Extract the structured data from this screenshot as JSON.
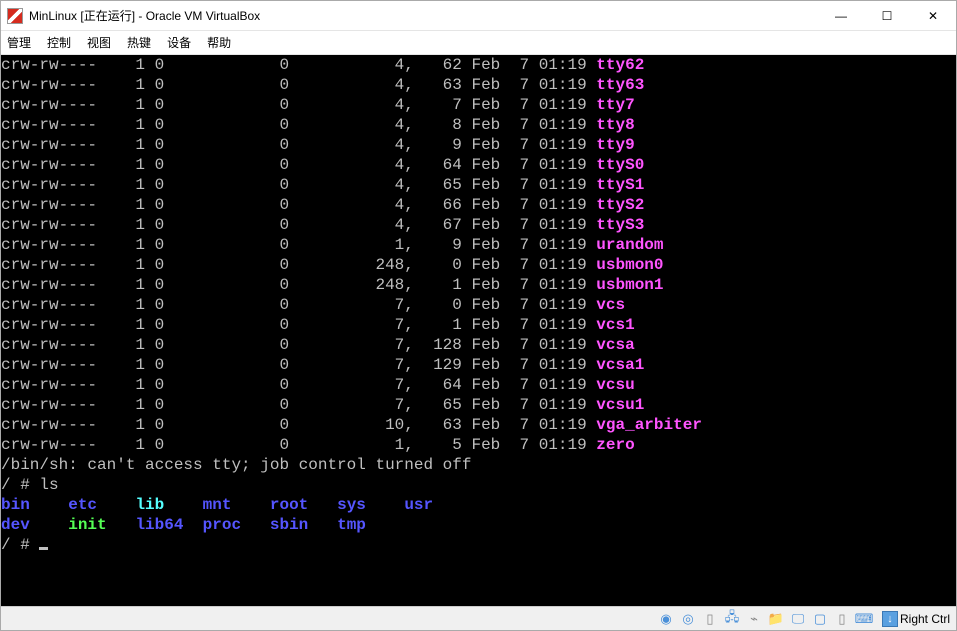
{
  "window": {
    "title": "MinLinux [正在运行] - Oracle VM VirtualBox"
  },
  "menu": {
    "items": [
      "管理",
      "控制",
      "视图",
      "热键",
      "设备",
      "帮助"
    ]
  },
  "terminal": {
    "listing": [
      {
        "perm": "crw-rw----",
        "links": "1",
        "owner": "0",
        "size": "0",
        "maj": "4,",
        "min": "62",
        "mon": "Feb",
        "day": "7",
        "time": "01:19",
        "name": "tty62",
        "cls": "magenta"
      },
      {
        "perm": "crw-rw----",
        "links": "1",
        "owner": "0",
        "size": "0",
        "maj": "4,",
        "min": "63",
        "mon": "Feb",
        "day": "7",
        "time": "01:19",
        "name": "tty63",
        "cls": "magenta"
      },
      {
        "perm": "crw-rw----",
        "links": "1",
        "owner": "0",
        "size": "0",
        "maj": "4,",
        "min": "7",
        "mon": "Feb",
        "day": "7",
        "time": "01:19",
        "name": "tty7",
        "cls": "magenta"
      },
      {
        "perm": "crw-rw----",
        "links": "1",
        "owner": "0",
        "size": "0",
        "maj": "4,",
        "min": "8",
        "mon": "Feb",
        "day": "7",
        "time": "01:19",
        "name": "tty8",
        "cls": "magenta"
      },
      {
        "perm": "crw-rw----",
        "links": "1",
        "owner": "0",
        "size": "0",
        "maj": "4,",
        "min": "9",
        "mon": "Feb",
        "day": "7",
        "time": "01:19",
        "name": "tty9",
        "cls": "magenta"
      },
      {
        "perm": "crw-rw----",
        "links": "1",
        "owner": "0",
        "size": "0",
        "maj": "4,",
        "min": "64",
        "mon": "Feb",
        "day": "7",
        "time": "01:19",
        "name": "ttyS0",
        "cls": "magenta"
      },
      {
        "perm": "crw-rw----",
        "links": "1",
        "owner": "0",
        "size": "0",
        "maj": "4,",
        "min": "65",
        "mon": "Feb",
        "day": "7",
        "time": "01:19",
        "name": "ttyS1",
        "cls": "magenta"
      },
      {
        "perm": "crw-rw----",
        "links": "1",
        "owner": "0",
        "size": "0",
        "maj": "4,",
        "min": "66",
        "mon": "Feb",
        "day": "7",
        "time": "01:19",
        "name": "ttyS2",
        "cls": "magenta"
      },
      {
        "perm": "crw-rw----",
        "links": "1",
        "owner": "0",
        "size": "0",
        "maj": "4,",
        "min": "67",
        "mon": "Feb",
        "day": "7",
        "time": "01:19",
        "name": "ttyS3",
        "cls": "magenta"
      },
      {
        "perm": "crw-rw----",
        "links": "1",
        "owner": "0",
        "size": "0",
        "maj": "1,",
        "min": "9",
        "mon": "Feb",
        "day": "7",
        "time": "01:19",
        "name": "urandom",
        "cls": "magenta"
      },
      {
        "perm": "crw-rw----",
        "links": "1",
        "owner": "0",
        "size": "0",
        "maj": "248,",
        "min": "0",
        "mon": "Feb",
        "day": "7",
        "time": "01:19",
        "name": "usbmon0",
        "cls": "magenta"
      },
      {
        "perm": "crw-rw----",
        "links": "1",
        "owner": "0",
        "size": "0",
        "maj": "248,",
        "min": "1",
        "mon": "Feb",
        "day": "7",
        "time": "01:19",
        "name": "usbmon1",
        "cls": "magenta"
      },
      {
        "perm": "crw-rw----",
        "links": "1",
        "owner": "0",
        "size": "0",
        "maj": "7,",
        "min": "0",
        "mon": "Feb",
        "day": "7",
        "time": "01:19",
        "name": "vcs",
        "cls": "magenta"
      },
      {
        "perm": "crw-rw----",
        "links": "1",
        "owner": "0",
        "size": "0",
        "maj": "7,",
        "min": "1",
        "mon": "Feb",
        "day": "7",
        "time": "01:19",
        "name": "vcs1",
        "cls": "magenta"
      },
      {
        "perm": "crw-rw----",
        "links": "1",
        "owner": "0",
        "size": "0",
        "maj": "7,",
        "min": "128",
        "mon": "Feb",
        "day": "7",
        "time": "01:19",
        "name": "vcsa",
        "cls": "magenta"
      },
      {
        "perm": "crw-rw----",
        "links": "1",
        "owner": "0",
        "size": "0",
        "maj": "7,",
        "min": "129",
        "mon": "Feb",
        "day": "7",
        "time": "01:19",
        "name": "vcsa1",
        "cls": "magenta"
      },
      {
        "perm": "crw-rw----",
        "links": "1",
        "owner": "0",
        "size": "0",
        "maj": "7,",
        "min": "64",
        "mon": "Feb",
        "day": "7",
        "time": "01:19",
        "name": "vcsu",
        "cls": "magenta"
      },
      {
        "perm": "crw-rw----",
        "links": "1",
        "owner": "0",
        "size": "0",
        "maj": "7,",
        "min": "65",
        "mon": "Feb",
        "day": "7",
        "time": "01:19",
        "name": "vcsu1",
        "cls": "magenta"
      },
      {
        "perm": "crw-rw----",
        "links": "1",
        "owner": "0",
        "size": "0",
        "maj": "10,",
        "min": "63",
        "mon": "Feb",
        "day": "7",
        "time": "01:19",
        "name": "vga_arbiter",
        "cls": "magenta"
      },
      {
        "perm": "crw-rw----",
        "links": "1",
        "owner": "0",
        "size": "0",
        "maj": "1,",
        "min": "5",
        "mon": "Feb",
        "day": "7",
        "time": "01:19",
        "name": "zero",
        "cls": "magenta"
      }
    ],
    "msg": "/bin/sh: can't access tty; job control turned off",
    "prompt1": "/ # ls",
    "ls_row1": [
      {
        "t": "bin",
        "cls": "blue"
      },
      {
        "t": "etc",
        "cls": "blue"
      },
      {
        "t": "lib",
        "cls": "cyanb"
      },
      {
        "t": "mnt",
        "cls": "blue"
      },
      {
        "t": "root",
        "cls": "blue"
      },
      {
        "t": "sys",
        "cls": "blue"
      },
      {
        "t": "usr",
        "cls": "blue"
      }
    ],
    "ls_row2": [
      {
        "t": "dev",
        "cls": "blue"
      },
      {
        "t": "init",
        "cls": "green"
      },
      {
        "t": "lib64",
        "cls": "blue"
      },
      {
        "t": "proc",
        "cls": "blue"
      },
      {
        "t": "sbin",
        "cls": "blue"
      },
      {
        "t": "tmp",
        "cls": "blue"
      }
    ],
    "prompt2": "/ # "
  },
  "statusbar": {
    "host_key": "Right Ctrl"
  }
}
